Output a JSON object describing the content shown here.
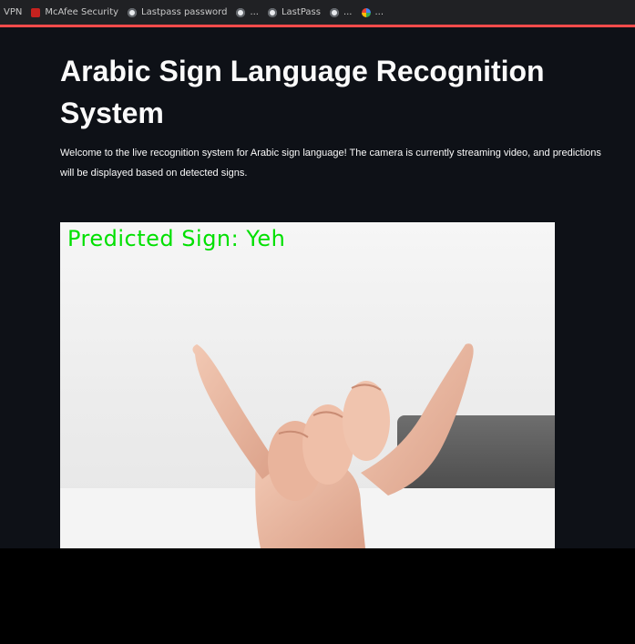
{
  "bookmarks": [
    {
      "label": "VPN",
      "icon": "none"
    },
    {
      "label": "McAfee Security",
      "icon": "mcafee-icon"
    },
    {
      "label": "Lastpass password",
      "icon": "globe-icon"
    },
    {
      "label": "...",
      "icon": "globe-icon"
    },
    {
      "label": "LastPass",
      "icon": "globe-icon"
    },
    {
      "label": "...",
      "icon": "globe-icon"
    },
    {
      "label": "...",
      "icon": "google-icon"
    }
  ],
  "app": {
    "title": "Arabic Sign Language Recognition System",
    "description": "Welcome to the live recognition system for Arabic sign language! The camera is currently streaming video, and predictions will be displayed based on detected signs."
  },
  "video": {
    "prediction_text": "Predicted Sign: Yeh"
  },
  "colors": {
    "background": "#0e1117",
    "accent": "#ff4b4b",
    "prediction": "#00e000"
  }
}
